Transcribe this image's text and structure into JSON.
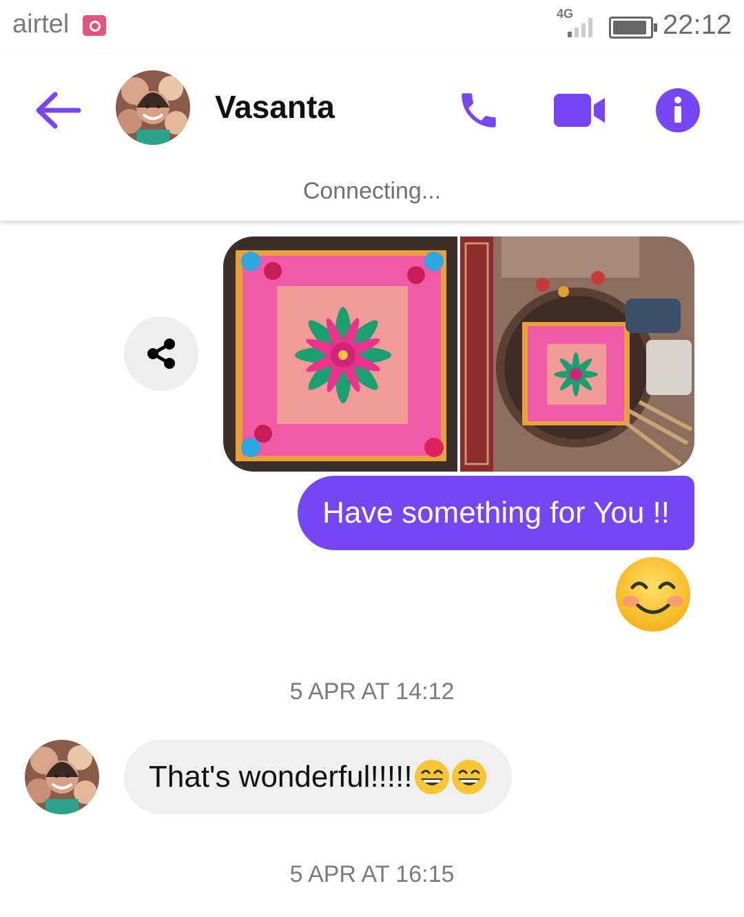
{
  "status_bar": {
    "carrier": "airtel",
    "network": "4G",
    "time": "22:12"
  },
  "header": {
    "contact_name": "Vasanta",
    "connection_status": "Connecting...",
    "accent_color": "#7646f5"
  },
  "messages": {
    "outgoing_text": "Have something for You !!",
    "outgoing_emoji": "smiling-face-with-smiling-eyes",
    "timestamp_1": "5 APR AT 14:12",
    "incoming_text": "That's wonderful!!!!!",
    "incoming_emojis": [
      "grinning-face-with-smiling-eyes",
      "grinning-face-with-smiling-eyes"
    ],
    "timestamp_2": "5 APR AT 16:15"
  },
  "icons": {
    "back": "back-arrow-icon",
    "call": "phone-icon",
    "video": "video-camera-icon",
    "info": "info-icon",
    "share": "share-icon",
    "sim": "sim-icon"
  }
}
